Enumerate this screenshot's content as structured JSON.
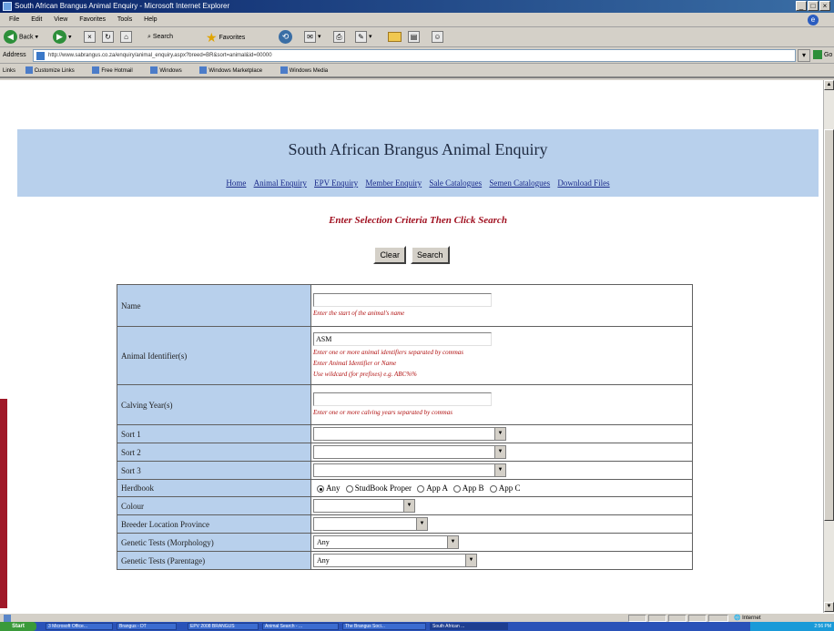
{
  "window": {
    "title": "South African Brangus Animal Enquiry - Microsoft Internet Explorer",
    "controls": [
      "_",
      "□",
      "×"
    ]
  },
  "menu": [
    "File",
    "Edit",
    "View",
    "Favorites",
    "Tools",
    "Help"
  ],
  "toolbar": {
    "back": "Back",
    "search": "Search",
    "favorites": "Favorites"
  },
  "address": {
    "label": "Address",
    "url": "http://www.sabrangus.co.za/enquiry/animal_enquiry.aspx?breed=BR&sort=animal&id=00000",
    "go": "Go"
  },
  "links": [
    "Links",
    "Customize Links",
    "Free Hotmail",
    "Windows",
    "Windows Marketplace",
    "Windows Media"
  ],
  "site": {
    "title": "South African Brangus Animal Enquiry",
    "nav": [
      "Home",
      "Animal Enquiry",
      "EPV Enquiry",
      "Member Enquiry",
      "Sale Catalogues",
      "Semen Catalogues",
      "Download Files"
    ],
    "instruction": "Enter Selection Criteria Then Click Search",
    "buttons": {
      "clear": "Clear",
      "search": "Search"
    }
  },
  "form": {
    "name": {
      "label": "Name",
      "value": "",
      "hint": "Enter the start of the animal's name"
    },
    "animal_id": {
      "label": "Animal Identifier(s)",
      "value": "ASM",
      "hints": [
        "Enter one or more animal identifiers separated by commas",
        "Enter Animal Identifier or Name",
        "Use wildcard (for prefixes) e.g. ABC%%"
      ]
    },
    "calving_year": {
      "label": "Calving Year(s)",
      "value": "",
      "hint": "Enter one or more calving years separated by commas"
    },
    "sort1": {
      "label": "Sort 1",
      "value": ""
    },
    "sort2": {
      "label": "Sort 2",
      "value": ""
    },
    "sort3": {
      "label": "Sort 3",
      "value": ""
    },
    "herdbook": {
      "label": "Herdbook",
      "options": [
        "Any",
        "StudBook Proper",
        "App A",
        "App B",
        "App C"
      ],
      "selected": "Any"
    },
    "colour": {
      "label": "Colour",
      "value": ""
    },
    "breeder_province": {
      "label": "Breeder Location Province",
      "value": ""
    },
    "genetic_tests_morph": {
      "label": "Genetic Tests (Morphology)",
      "value": "Any"
    },
    "genetic_tests_parent": {
      "label": "Genetic Tests (Parentage)",
      "value": "Any"
    }
  },
  "statusbar": {
    "zone": "Internet"
  },
  "taskbar": {
    "start": "Start",
    "tasks": [
      "3 Microsoft Office...",
      "Brangus - DT",
      "EPV 2008 BRANGUS",
      "Animal Search - ...",
      "The Brangus Soci...",
      "South African ..."
    ],
    "clock": "2:56 PM"
  }
}
